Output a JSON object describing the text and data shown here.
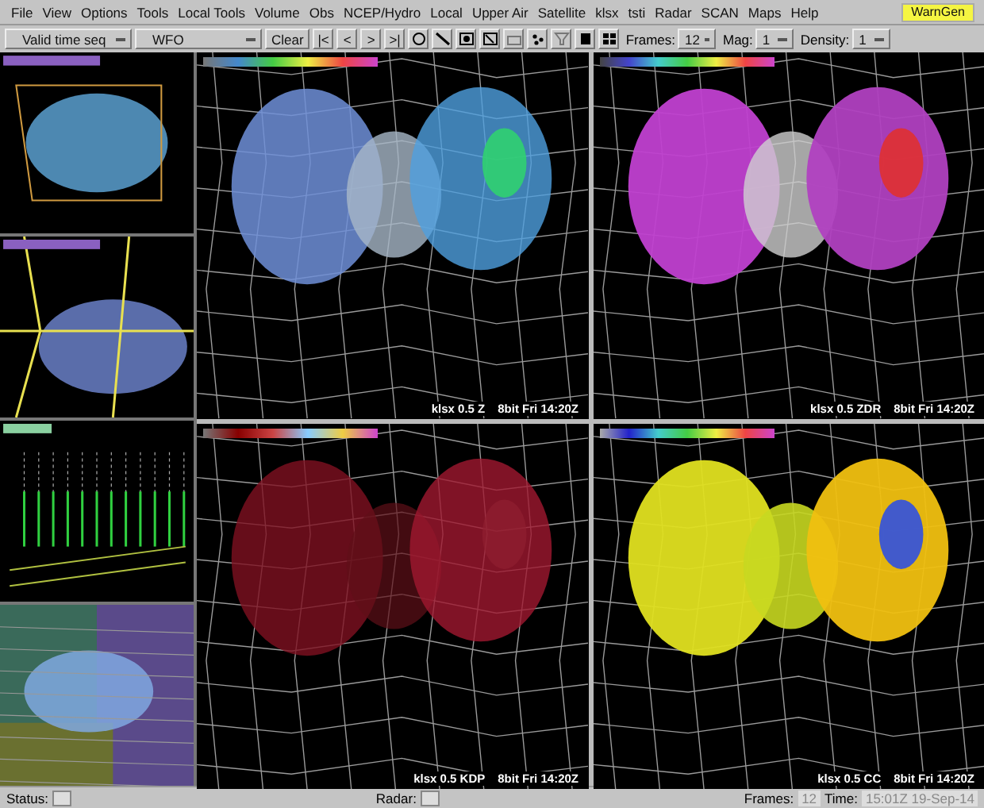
{
  "menu": [
    "File",
    "View",
    "Options",
    "Tools",
    "Local Tools",
    "Volume",
    "Obs",
    "NCEP/Hydro",
    "Local",
    "Upper Air",
    "Satellite",
    "klsx",
    "tsti",
    "Radar",
    "SCAN",
    "Maps",
    "Help"
  ],
  "warngen_button": "WarnGen",
  "toolbar": {
    "dropdowns": [
      "Valid time seq",
      "WFO"
    ],
    "clear_button": "Clear",
    "frame_buttons": [
      "|<",
      "<",
      ">",
      ">|"
    ],
    "frames_label": "Frames:",
    "frames_value": "12",
    "mag_label": "Mag:",
    "mag_value": "1",
    "density_label": "Density:",
    "density_value": "1"
  },
  "main_panes": [
    {
      "product": "klsx 0.5 Z",
      "time": "8bit Fri 14:20Z",
      "kind": "reflectivity"
    },
    {
      "product": "klsx 0.5 ZDR",
      "time": "8bit Fri 14:20Z",
      "kind": "zdr"
    },
    {
      "product": "klsx 0.5 KDP",
      "time": "8bit Fri 14:20Z",
      "kind": "kdp"
    },
    {
      "product": "klsx 0.5 CC",
      "time": "8bit Fri 14:20Z",
      "kind": "cc"
    }
  ],
  "status_bar": {
    "status_label": "Status:",
    "radar_label": "Radar:",
    "frames_label": "Frames:",
    "frames_value": "12",
    "time_label": "Time:",
    "time_value": "15:01Z 19-Sep-14"
  }
}
